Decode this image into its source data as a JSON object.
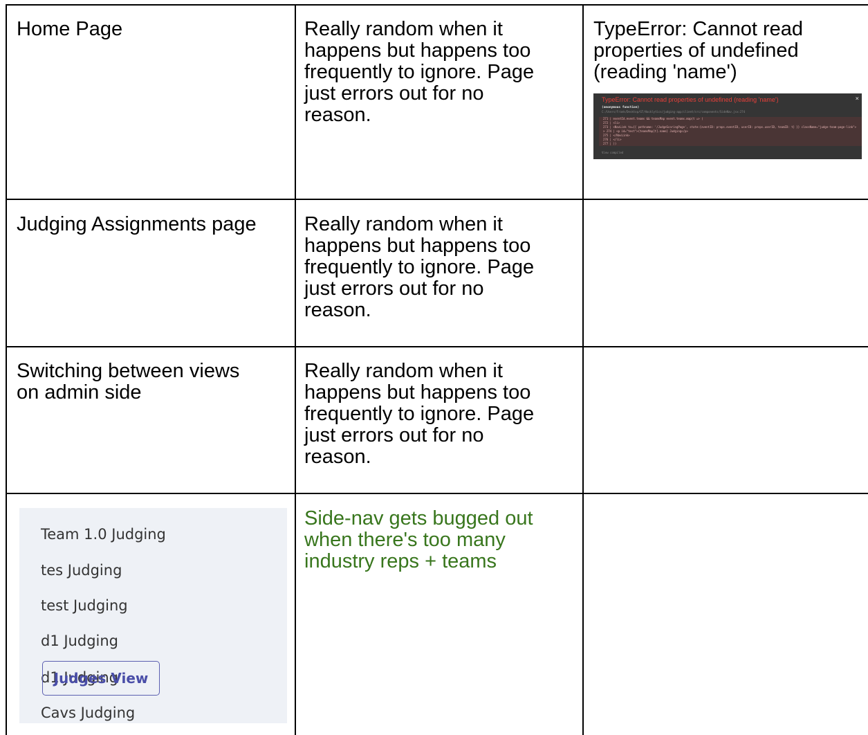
{
  "rows": [
    {
      "col1_lines": [
        "Home Page"
      ],
      "col2_lines": [
        "Really random when it",
        "happens but happens too",
        "frequently to ignore. Page",
        "just errors out for no",
        "reason."
      ],
      "col3_lines": [
        "TypeError: Cannot read",
        "properties of undefined",
        "(reading 'name')"
      ]
    },
    {
      "col1_lines": [
        "Judging Assignments page"
      ],
      "col2_lines": [
        "Really random when it",
        "happens but happens too",
        "frequently to ignore. Page",
        "just errors out for no",
        "reason."
      ]
    },
    {
      "col1_lines": [
        "Switching between views",
        "on admin side"
      ],
      "col2_lines": [
        "Really random when it",
        "happens but happens too",
        "frequently to ignore. Page",
        "just errors out for no",
        "reason."
      ]
    },
    {
      "col2_lines": [
        "Side-nav gets bugged out",
        "when there's too many",
        "industry reps + teams"
      ]
    }
  ],
  "error_screenshot": {
    "title": "TypeError: Cannot read properties of undefined (reading 'name')",
    "close": "×",
    "function_label": "(anonymous function)",
    "path": "C:/Users/Frank/Desktop/GT/Hacklytics/judging-app/client/src/components/SideNav.jsx:274",
    "code_lines": [
      "  271 | eventId.event.teams && teamsMap  event.teams.map(t => (",
      "  272 |    <li>",
      "  273 |      <NavLink to={{ pathname: '/JudgeScoringPage', state:{eventID: props.eventID, userID: props.userID, teamID: t} }} className=\"judge-team-page-link\">",
      "> 274 |        <p id=\"test\">{teamsMap[t].name} Judging</p>",
      "  275 |      </NavLink>",
      "  276 |    </li>",
      "  277 | ))"
    ],
    "footer": "View compiled"
  },
  "sidenav_screenshot": {
    "items": [
      "Team 1.0 Judging",
      "tes Judging",
      "test Judging",
      "d1 Judging",
      "d1 Judging",
      "Cavs Judging"
    ],
    "button_label": "Judges View"
  },
  "colors": {
    "green_text": "#38761d",
    "error_red": "#e8403a",
    "nav_bg": "#eef1f6",
    "button_purple": "#4a4ea8"
  }
}
